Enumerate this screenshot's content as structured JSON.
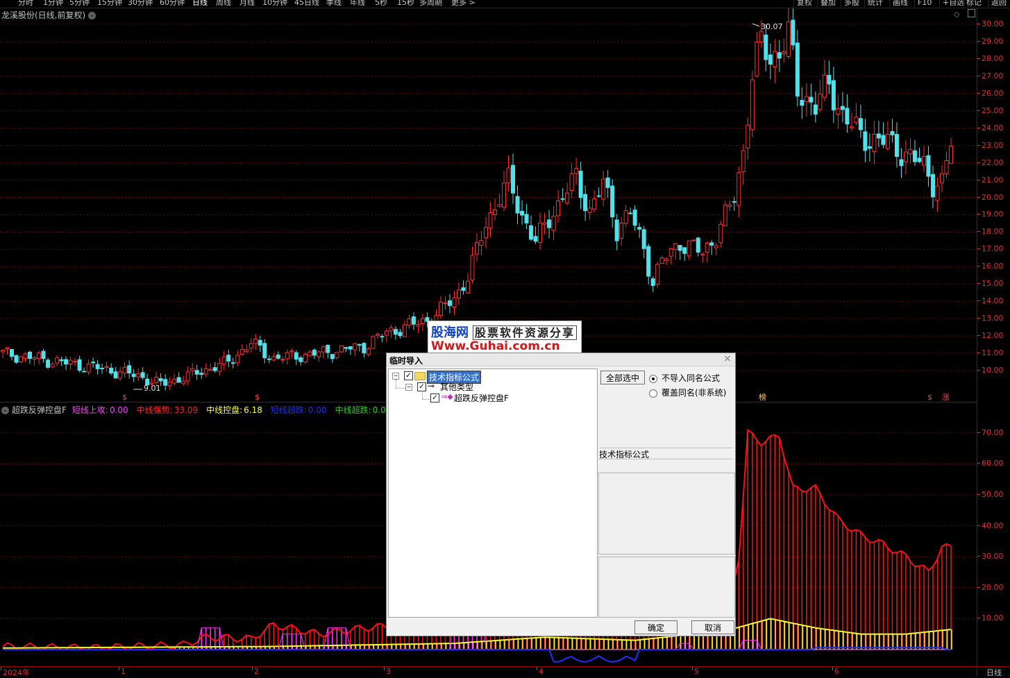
{
  "toolbar": {
    "periods": [
      "分时",
      "1分钟",
      "5分钟",
      "15分钟",
      "30分钟",
      "60分钟",
      "日线",
      "周线",
      "月线",
      "10分钟",
      "45日线",
      "季线",
      "年线",
      "5秒",
      "15秒",
      "多周期",
      "更多 >"
    ],
    "active_period": "日线",
    "right_buttons": [
      "复权",
      "叠加",
      "多股",
      "统计",
      "画线",
      "F10",
      "+自选",
      "标记",
      "返回"
    ]
  },
  "main_chart": {
    "title": "龙溪股份(日线,前复权)",
    "high_label": "30.07",
    "low_label": "9.01",
    "y_ticks": [
      "30.00",
      "29.00",
      "28.00",
      "27.00",
      "26.00",
      "25.00",
      "24.00",
      "23.00",
      "22.00",
      "21.00",
      "20.00",
      "19.00",
      "18.00",
      "17.00",
      "16.00",
      "15.00",
      "14.00",
      "13.00",
      "12.00",
      "11.00",
      "10.00"
    ],
    "markers": [
      "$",
      "$",
      "$",
      "榜",
      "$",
      "涨"
    ],
    "colors": {
      "up": "#ff3030",
      "down": "#54e0e8",
      "grid": "#7a0000"
    }
  },
  "indicator": {
    "name": "超跌反弹控盘F",
    "items": [
      {
        "label": "短线上攻:",
        "value": "0.00",
        "color": "#ff40ff"
      },
      {
        "label": "中线强势:",
        "value": "33.09",
        "color": "#ff2020"
      },
      {
        "label": "中线控盘:",
        "value": "6.18",
        "color": "#ffff40"
      },
      {
        "label": "短线超跌:",
        "value": "0.00",
        "color": "#2030ff"
      },
      {
        "label": "中线超跌:",
        "value": "0.00",
        "color": "#20d020"
      }
    ],
    "y_ticks": [
      "70.00",
      "60.00",
      "50.00",
      "40.00",
      "30.00",
      "20.00",
      "10.00"
    ]
  },
  "x_axis": {
    "ticks": [
      "2024年",
      "1",
      "2",
      "3",
      "4",
      "5",
      "6"
    ],
    "period_label": "日线"
  },
  "watermark": {
    "brand": "股海网",
    "slogan": "股票软件资源分享",
    "url": "Www.Guhai.com.cn"
  },
  "dialog": {
    "title": "临时导入",
    "tree": {
      "root": "技术指标公式",
      "child": "其他类型",
      "leaf": "超跌反弹控盘F"
    },
    "select_all": "全部选中",
    "radio_options": [
      "不导入同名公式",
      "覆盖同名(非系统)"
    ],
    "type_label": "技术指标公式",
    "ok": "确定",
    "cancel": "取消"
  }
}
